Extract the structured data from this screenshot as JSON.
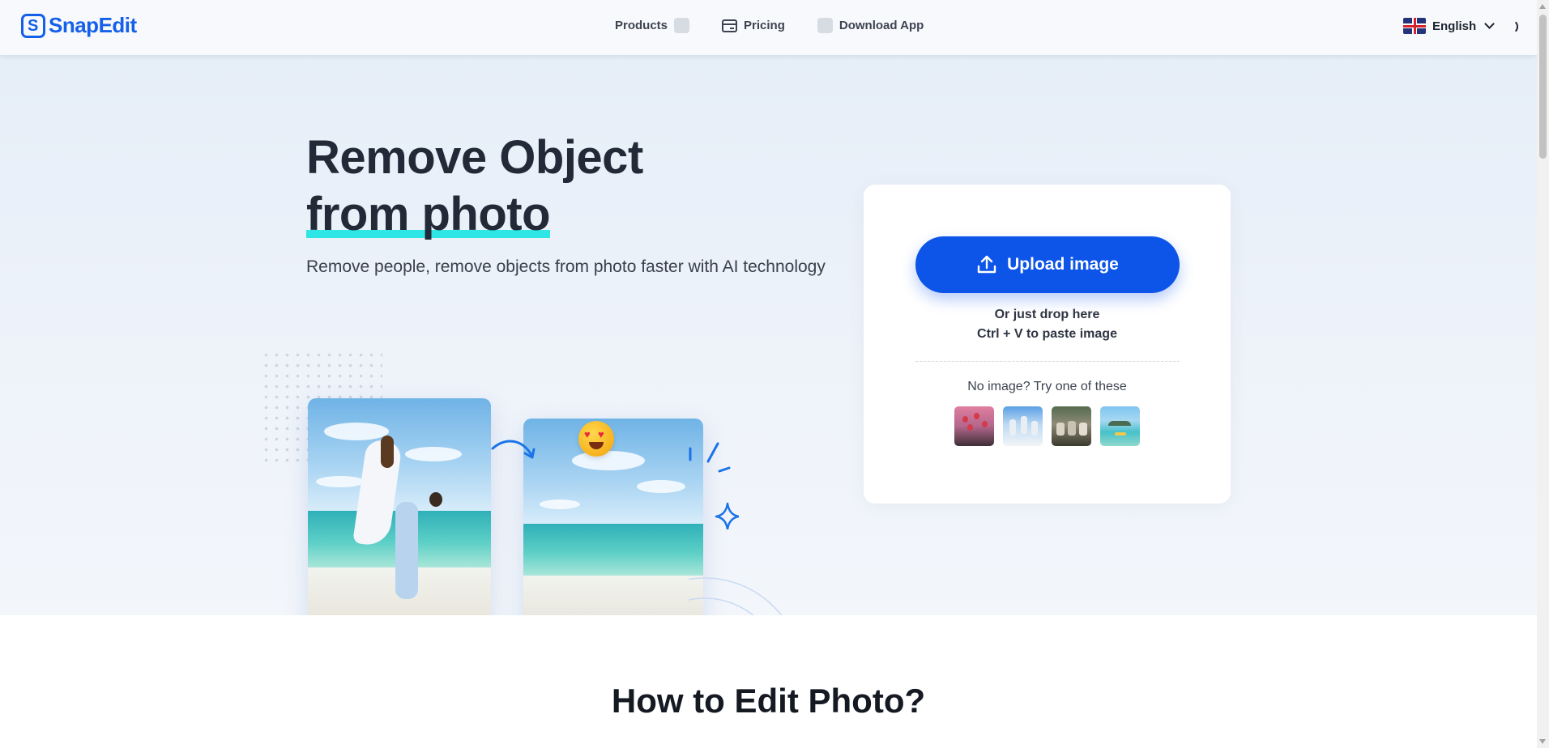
{
  "header": {
    "brand": "SnapEdit",
    "nav": [
      {
        "label": "Products",
        "icon": "placeholder-icon"
      },
      {
        "label": "Pricing",
        "icon": "pricing-card-icon"
      },
      {
        "label": "Download App",
        "icon": "download-app-icon"
      }
    ],
    "language": {
      "label": "English",
      "flag": "uk-flag-icon"
    }
  },
  "hero": {
    "title_line1": "Remove Object",
    "title_line2": "from photo",
    "subtitle": "Remove people, remove objects from photo faster with AI technology",
    "highlight_color": "#2ee6e6"
  },
  "upload": {
    "button_label": "Upload image",
    "drop_hint": "Or just drop here",
    "paste_hint": "Ctrl + V to paste image",
    "try_label": "No image? Try one of these",
    "samples": [
      "hot-air-balloons",
      "people-jumping",
      "group-photo",
      "island-sea"
    ],
    "accent_color": "#0d55e8"
  },
  "section": {
    "title": "How to Edit Photo?"
  }
}
